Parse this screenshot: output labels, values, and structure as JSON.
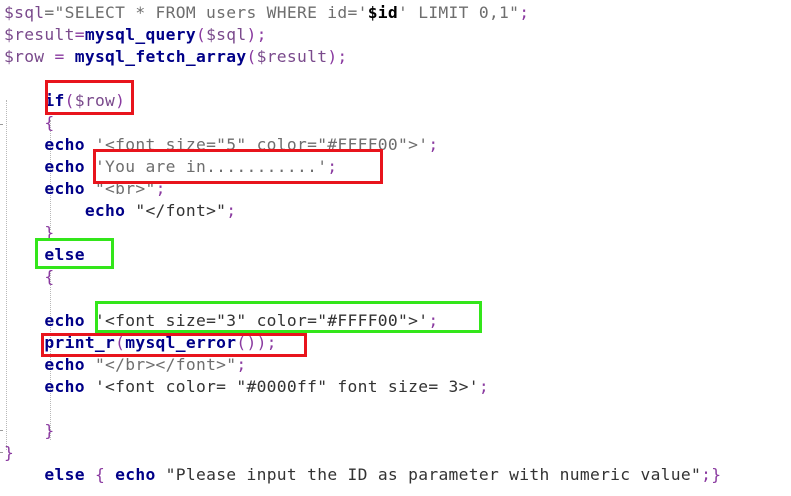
{
  "editor": {
    "lines": [
      [
        {
          "t": "$sql",
          "c": "var"
        },
        {
          "t": "=\"SELECT * FROM users WHERE id='",
          "c": "str"
        },
        {
          "t": "$id",
          "c": "hl"
        },
        {
          "t": "' LIMIT 0,1\"",
          "c": "str"
        },
        {
          "t": ";",
          "c": "punc"
        }
      ],
      [
        {
          "t": "$result",
          "c": "var"
        },
        {
          "t": "=",
          "c": "op"
        },
        {
          "t": "mysql_query",
          "c": "fn"
        },
        {
          "t": "(",
          "c": "punc"
        },
        {
          "t": "$sql",
          "c": "var"
        },
        {
          "t": ");",
          "c": "punc"
        }
      ],
      [
        {
          "t": "$row",
          "c": "var"
        },
        {
          "t": " = ",
          "c": "op"
        },
        {
          "t": "mysql_fetch_array",
          "c": "fn"
        },
        {
          "t": "(",
          "c": "punc"
        },
        {
          "t": "$result",
          "c": "var"
        },
        {
          "t": ");",
          "c": "punc"
        }
      ],
      [],
      [
        {
          "t": "    ",
          "c": "plain"
        },
        {
          "t": "if",
          "c": "kw"
        },
        {
          "t": "(",
          "c": "punc"
        },
        {
          "t": "$row",
          "c": "var"
        },
        {
          "t": ")",
          "c": "punc"
        }
      ],
      [
        {
          "t": "    ",
          "c": "plain"
        },
        {
          "t": "{",
          "c": "punc"
        }
      ],
      [
        {
          "t": "    ",
          "c": "plain"
        },
        {
          "t": "echo",
          "c": "kw"
        },
        {
          "t": " '<font size=\"5\" color=\"#FFFF00\">'",
          "c": "str"
        },
        {
          "t": ";",
          "c": "punc"
        }
      ],
      [
        {
          "t": "    ",
          "c": "plain"
        },
        {
          "t": "echo",
          "c": "kw"
        },
        {
          "t": " 'You are in...........'",
          "c": "str"
        },
        {
          "t": ";",
          "c": "punc"
        }
      ],
      [
        {
          "t": "    ",
          "c": "plain"
        },
        {
          "t": "echo",
          "c": "kw"
        },
        {
          "t": " \"<br>\"",
          "c": "str"
        },
        {
          "t": ";",
          "c": "punc"
        }
      ],
      [
        {
          "t": "        ",
          "c": "plain"
        },
        {
          "t": "echo",
          "c": "kw"
        },
        {
          "t": " \"</font>\"",
          "c": "plain"
        },
        {
          "t": ";",
          "c": "punc"
        }
      ],
      [
        {
          "t": "    ",
          "c": "plain"
        },
        {
          "t": "}",
          "c": "punc"
        }
      ],
      [
        {
          "t": "    ",
          "c": "plain"
        },
        {
          "t": "else",
          "c": "kw"
        }
      ],
      [
        {
          "t": "    ",
          "c": "plain"
        },
        {
          "t": "{",
          "c": "punc"
        }
      ],
      [],
      [
        {
          "t": "    ",
          "c": "plain"
        },
        {
          "t": "echo",
          "c": "kw"
        },
        {
          "t": " '<font size=\"3\" color=\"#FFFF00\">'",
          "c": "plain"
        },
        {
          "t": ";",
          "c": "punc"
        }
      ],
      [
        {
          "t": "    ",
          "c": "plain"
        },
        {
          "t": "print_r",
          "c": "fn"
        },
        {
          "t": "(",
          "c": "punc"
        },
        {
          "t": "mysql_error",
          "c": "fn"
        },
        {
          "t": "());",
          "c": "punc"
        }
      ],
      [
        {
          "t": "    ",
          "c": "plain"
        },
        {
          "t": "echo",
          "c": "kw"
        },
        {
          "t": " \"</br></font>\"",
          "c": "str"
        },
        {
          "t": ";",
          "c": "punc"
        }
      ],
      [
        {
          "t": "    ",
          "c": "plain"
        },
        {
          "t": "echo",
          "c": "kw"
        },
        {
          "t": " '<font color= \"#0000ff\" font size= 3>'",
          "c": "plain"
        },
        {
          "t": ";",
          "c": "punc"
        }
      ],
      [],
      [
        {
          "t": "    ",
          "c": "plain"
        },
        {
          "t": "}",
          "c": "punc"
        }
      ],
      [
        {
          "t": "}",
          "c": "punc"
        }
      ],
      [],
      [
        {
          "t": "    ",
          "c": "plain"
        },
        {
          "t": "else",
          "c": "kw"
        },
        {
          "t": " { ",
          "c": "punc"
        },
        {
          "t": "echo",
          "c": "kw"
        },
        {
          "t": " \"Please input the ID as parameter with numeric value\"",
          "c": "plain"
        },
        {
          "t": ";}",
          "c": "punc"
        }
      ]
    ]
  },
  "annotations": {
    "highlight_colors": {
      "red": "#e8141c",
      "green": "#33e61a"
    }
  }
}
